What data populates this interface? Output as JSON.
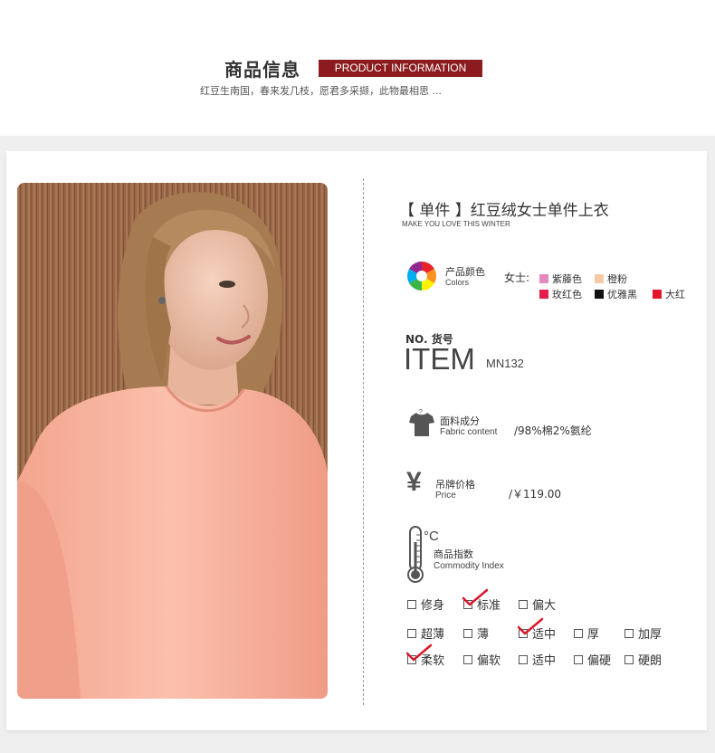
{
  "header": {
    "title_cn": "商品信息",
    "title_en": "PRODUCT INFORMATION",
    "subtitle": "红豆生南国，春来发几枝，愿君多采撷，此物最相思 ..."
  },
  "product": {
    "title": "【 单件 】红豆绒女士单件上衣",
    "tagline": "MAKE YOU LOVE THIS WINTER"
  },
  "colors": {
    "label_cn": "产品颜色",
    "label_en": "Colors",
    "group_label": "女士:",
    "swatches": [
      {
        "name": "紫藤色",
        "hex": "#e48ac0"
      },
      {
        "name": "橙粉",
        "hex": "#f8c9a9"
      },
      {
        "name": "玫红色",
        "hex": "#e21f4d"
      },
      {
        "name": "优雅黑",
        "hex": "#111111"
      },
      {
        "name": "大红",
        "hex": "#e2152b"
      }
    ]
  },
  "item": {
    "label_no": "NO. 货号",
    "label_item": "ITEM",
    "value": "MN132"
  },
  "fabric": {
    "label_cn": "面料成分",
    "label_en": "Fabric content",
    "value": "/98%棉2%氨纶",
    "icon": "shirt-icon"
  },
  "price": {
    "label_cn": "吊牌价格",
    "label_en": "Price",
    "value": "/￥119.00",
    "icon": "yen-icon",
    "icon_glyph": "¥"
  },
  "index": {
    "label_cn": "商品指数",
    "label_en": "Commodity Index",
    "degree_label": "°C",
    "icon": "thermometer-icon",
    "rows": [
      {
        "options": [
          {
            "label": "修身",
            "checked": false
          },
          {
            "label": "标准",
            "checked": true
          },
          {
            "label": "偏大",
            "checked": false
          }
        ]
      },
      {
        "options": [
          {
            "label": "超薄",
            "checked": false
          },
          {
            "label": "薄",
            "checked": false
          },
          {
            "label": "适中",
            "checked": true
          },
          {
            "label": "厚",
            "checked": false
          },
          {
            "label": "加厚",
            "checked": false
          }
        ]
      },
      {
        "options": [
          {
            "label": "柔软",
            "checked": true
          },
          {
            "label": "偏软",
            "checked": false
          },
          {
            "label": "适中",
            "checked": false
          },
          {
            "label": "偏硬",
            "checked": false
          },
          {
            "label": "硬朗",
            "checked": false
          }
        ]
      }
    ]
  },
  "theme": {
    "accent": "#8b1b1e",
    "check_color": "#d8182c"
  }
}
